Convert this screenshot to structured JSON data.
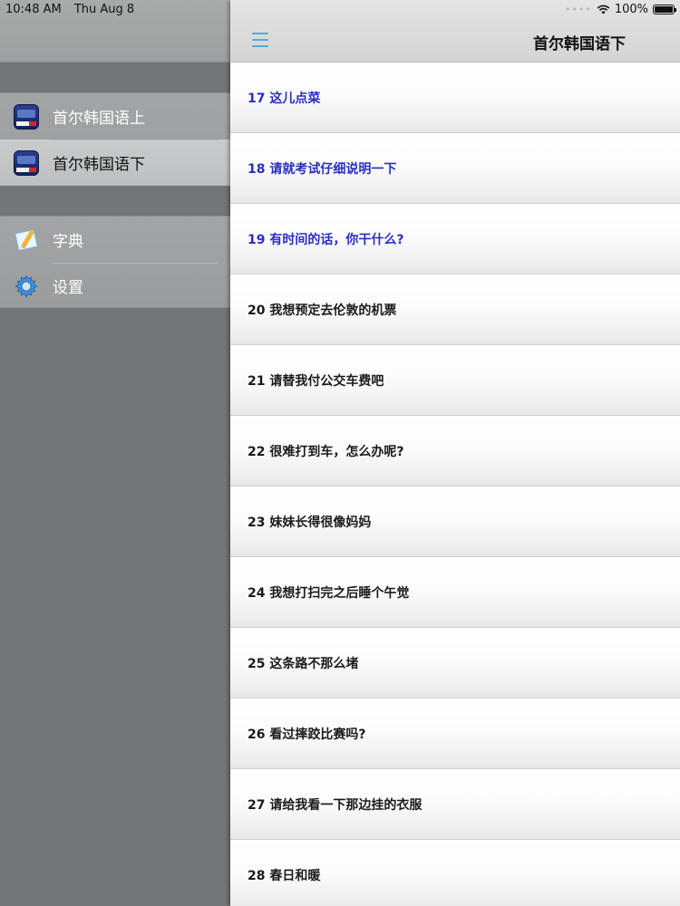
{
  "status_bar": {
    "time": "10:48 AM",
    "date": "Thu Aug 8",
    "battery": "100%",
    "battery_level": 1.0
  },
  "sidebar": {
    "books": [
      {
        "label": "首尔韩国语上",
        "icon": "book-cover-icon",
        "selected": false
      },
      {
        "label": "首尔韩国语下",
        "icon": "book-cover-icon",
        "selected": true
      }
    ],
    "tools": [
      {
        "label": "字典",
        "icon": "dictionary-icon"
      },
      {
        "label": "设置",
        "icon": "gear-icon"
      }
    ]
  },
  "navbar": {
    "menu_icon": "hamburger-menu-icon",
    "title": "首尔韩国语下"
  },
  "colors": {
    "visited_link": "#2a2fc2",
    "accent": "#57a9d8"
  },
  "lessons": [
    {
      "label": "17 这儿点菜",
      "visited": true
    },
    {
      "label": "18 请就考试仔细说明一下",
      "visited": true
    },
    {
      "label": "19 有时间的话，你干什么?",
      "visited": true
    },
    {
      "label": "20 我想预定去伦敦的机票",
      "visited": false
    },
    {
      "label": "21 请替我付公交车费吧",
      "visited": false
    },
    {
      "label": "22 很难打到车，怎么办呢?",
      "visited": false
    },
    {
      "label": "23 妹妹长得很像妈妈",
      "visited": false
    },
    {
      "label": "24 我想打扫完之后睡个午觉",
      "visited": false
    },
    {
      "label": "25 这条路不那么堵",
      "visited": false
    },
    {
      "label": "26 看过摔跤比赛吗?",
      "visited": false
    },
    {
      "label": "27 请给我看一下那边挂的衣服",
      "visited": false
    },
    {
      "label": "28 春日和暖",
      "visited": false
    }
  ]
}
